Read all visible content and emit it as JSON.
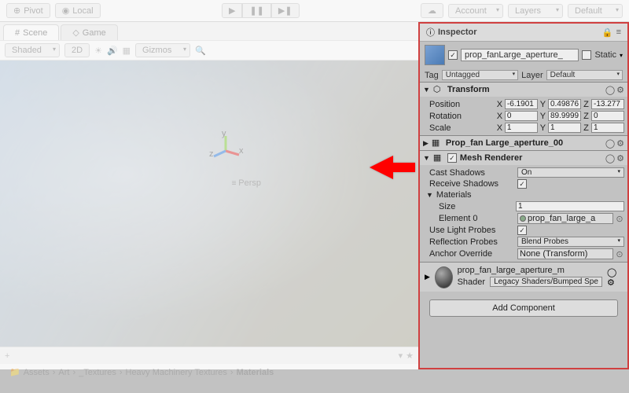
{
  "toolbar": {
    "pivot": "Pivot",
    "local": "Local",
    "account": "Account",
    "layers": "Layers",
    "default": "Default"
  },
  "tabs": {
    "scene": "Scene",
    "game": "Game"
  },
  "scene_toolbar": {
    "shaded": "Shaded",
    "mode_2d": "2D",
    "gizmos": "Gizmos"
  },
  "viewport": {
    "persp": "Persp"
  },
  "breadcrumb": [
    "Assets",
    "Art",
    "_Textures",
    "Heavy Machinery Textures",
    "Materials"
  ],
  "inspector": {
    "title": "Inspector",
    "obj_name": "prop_fanLarge_aperture_",
    "static": "Static",
    "tag_label": "Tag",
    "tag_value": "Untagged",
    "layer_label": "Layer",
    "layer_value": "Default"
  },
  "transform": {
    "title": "Transform",
    "position": "Position",
    "rotation": "Rotation",
    "scale": "Scale",
    "px": "-6.1901",
    "py": "0.49876",
    "pz": "-13.277",
    "rx": "0",
    "ry": "89.9999",
    "rz": "0",
    "sx": "1",
    "sy": "1",
    "sz": "1",
    "x": "X",
    "y": "Y",
    "z": "Z"
  },
  "mesh_filter": {
    "title": "Prop_fan Large_aperture_00"
  },
  "mesh_renderer": {
    "title": "Mesh Renderer",
    "cast_shadows_label": "Cast Shadows",
    "cast_shadows_value": "On",
    "receive_shadows_label": "Receive Shadows",
    "materials_label": "Materials",
    "size_label": "Size",
    "size_value": "1",
    "element0_label": "Element 0",
    "element0_value": "prop_fan_large_a",
    "use_light_probes": "Use Light Probes",
    "reflection_probes_label": "Reflection Probes",
    "reflection_probes_value": "Blend Probes",
    "anchor_override_label": "Anchor Override",
    "anchor_override_value": "None (Transform)"
  },
  "material": {
    "name": "prop_fan_large_aperture_m",
    "shader_label": "Shader",
    "shader_value": "Legacy Shaders/Bumped Spe"
  },
  "add_component": "Add Component"
}
